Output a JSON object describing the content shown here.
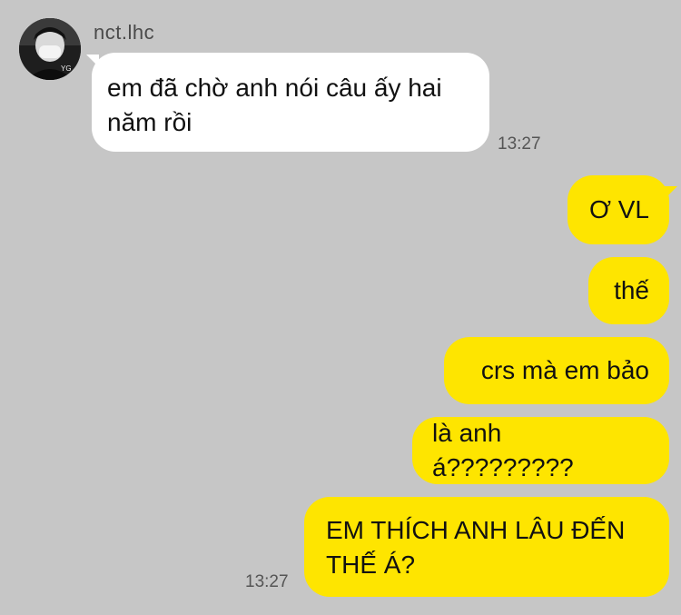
{
  "chat": {
    "sender_name": "nct.lhc",
    "avatar_icon": "profile-photo",
    "incoming": {
      "text": "em đã chờ anh nói câu ấy hai năm rồi",
      "time": "13:27"
    },
    "outgoing": [
      {
        "text": "Ơ VL"
      },
      {
        "text": "thế"
      },
      {
        "text": "crs mà em bảo"
      },
      {
        "text": "là anh á?????????"
      },
      {
        "text": "EM THÍCH ANH LÂU ĐẾN THẾ Á?",
        "time": "13:27"
      }
    ]
  },
  "colors": {
    "background": "#c6c6c6",
    "incoming_bubble": "#ffffff",
    "outgoing_bubble": "#fee500"
  }
}
